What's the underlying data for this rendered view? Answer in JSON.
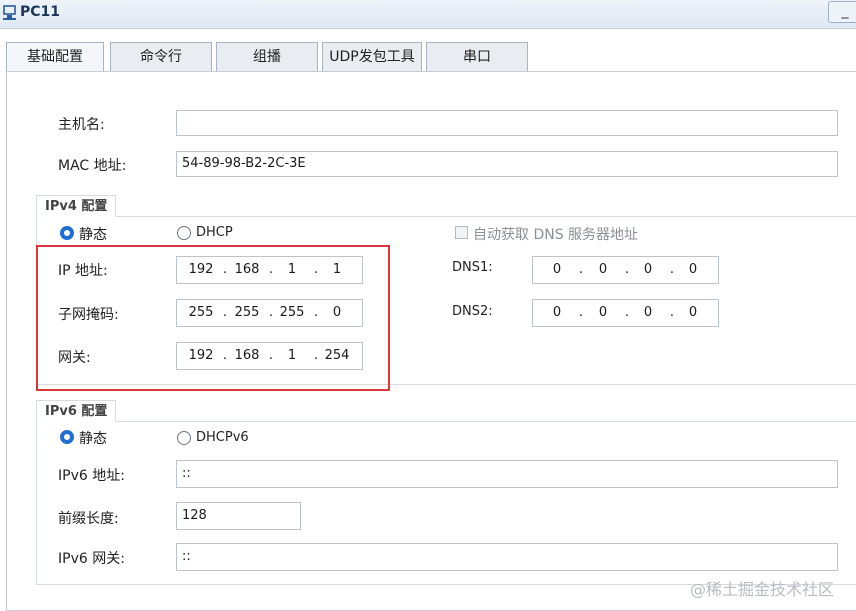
{
  "window": {
    "title": "PC11",
    "minimize": "_"
  },
  "tabs": [
    {
      "label": "基础配置",
      "active": true
    },
    {
      "label": "命令行",
      "active": false
    },
    {
      "label": "组播",
      "active": false
    },
    {
      "label": "UDP发包工具",
      "active": false
    },
    {
      "label": "串口",
      "active": false
    }
  ],
  "basic": {
    "hostname_label": "主机名:",
    "hostname_value": "",
    "mac_label": "MAC 地址:",
    "mac_value": "54-89-98-B2-2C-3E"
  },
  "ipv4": {
    "group_title": "IPv4 配置",
    "static_label": "静态",
    "dhcp_label": "DHCP",
    "auto_dns_label": "自动获取 DNS 服务器地址",
    "mode": "static",
    "ip_label": "IP 地址:",
    "mask_label": "子网掩码:",
    "gateway_label": "网关:",
    "dns1_label": "DNS1:",
    "dns2_label": "DNS2:",
    "ip": [
      "192",
      "168",
      "1",
      "1"
    ],
    "mask": [
      "255",
      "255",
      "255",
      "0"
    ],
    "gateway": [
      "192",
      "168",
      "1",
      "254"
    ],
    "dns1": [
      "0",
      "0",
      "0",
      "0"
    ],
    "dns2": [
      "0",
      "0",
      "0",
      "0"
    ],
    "dot": "."
  },
  "ipv6": {
    "group_title": "IPv6 配置",
    "static_label": "静态",
    "dhcp_label": "DHCPv6",
    "mode": "static",
    "addr_label": "IPv6 地址:",
    "addr_value": "::",
    "prefix_label": "前缀长度:",
    "prefix_value": "128",
    "gateway_label": "IPv6 网关:",
    "gateway_value": "::"
  },
  "watermark": "@稀土掘金技术社区",
  "colors": {
    "highlight": "#d9383b",
    "radio_selected": "#1f6fd1"
  }
}
